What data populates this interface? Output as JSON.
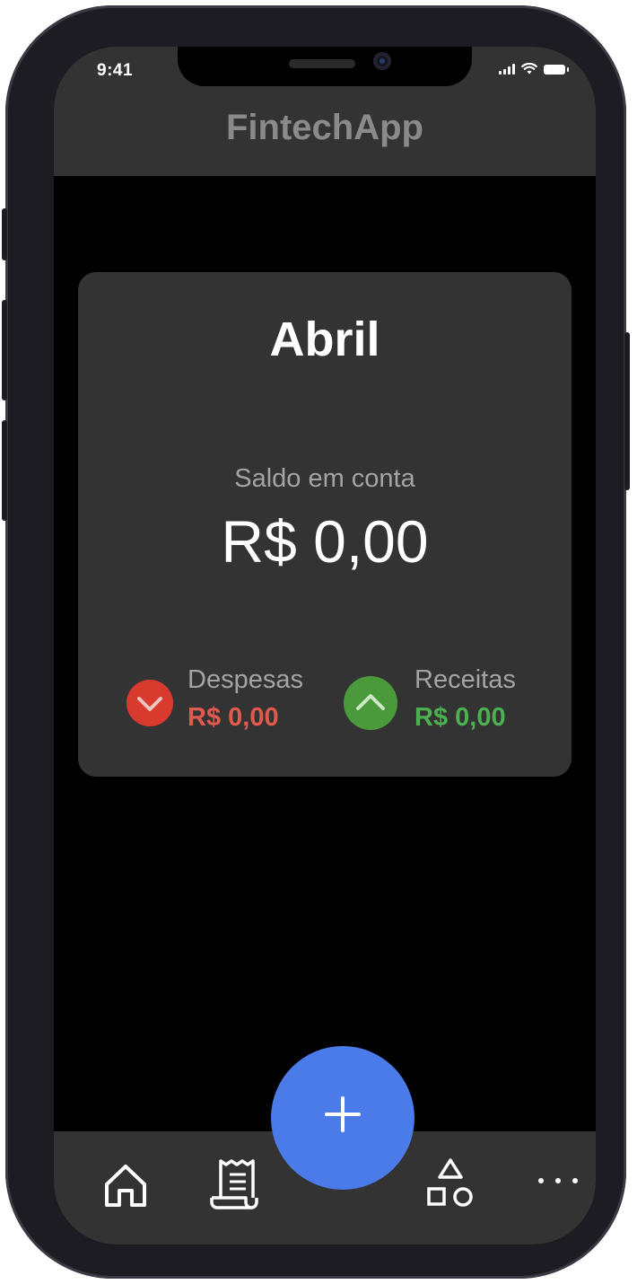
{
  "status_bar": {
    "time": "9:41"
  },
  "header": {
    "title": "FintechApp"
  },
  "summary_card": {
    "month": "Abril",
    "balance_label": "Saldo em conta",
    "balance_value": "R$ 0,00",
    "expenses": {
      "label": "Despesas",
      "value": "R$ 0,00",
      "color": "#e05a4e",
      "icon": "chevron-down-icon"
    },
    "income": {
      "label": "Receitas",
      "value": "R$ 0,00",
      "color": "#4caf50",
      "icon": "chevron-up-icon"
    }
  },
  "bottom_nav": {
    "items": [
      {
        "icon": "home-icon"
      },
      {
        "icon": "receipt-icon"
      },
      {
        "icon": "categories-icon"
      },
      {
        "icon": "more-icon"
      }
    ],
    "fab_icon": "plus-icon",
    "fab_color": "#4a7be8"
  },
  "colors": {
    "background": "#000000",
    "surface": "#333333",
    "header_title": "#8a8a8a",
    "expense_icon_bg": "#d93a2e",
    "income_icon_bg": "#4a9a3c"
  }
}
